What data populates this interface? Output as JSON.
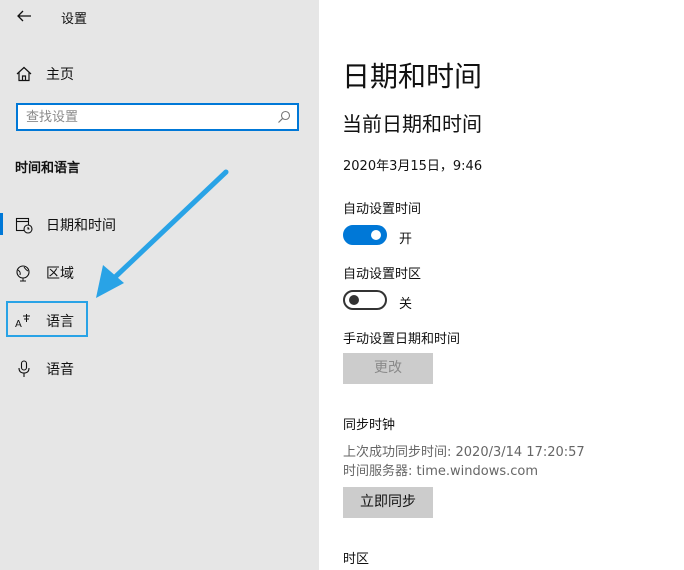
{
  "app": {
    "title": "设置"
  },
  "sidebar": {
    "home_label": "主页",
    "search": {
      "placeholder": "查找设置",
      "value": ""
    },
    "section_title": "时间和语言",
    "items": [
      {
        "label": "日期和时间",
        "icon": "calendar-clock-icon",
        "active": true
      },
      {
        "label": "区域",
        "icon": "globe-icon"
      },
      {
        "label": "语言",
        "icon": "language-icon",
        "highlighted": true
      },
      {
        "label": "语音",
        "icon": "microphone-icon"
      }
    ]
  },
  "main": {
    "page_title": "日期和时间",
    "current_heading": "当前日期和时间",
    "current_datetime": "2020年3月15日，9:46",
    "auto_time": {
      "label": "自动设置时间",
      "state": "开",
      "on": true
    },
    "auto_timezone": {
      "label": "自动设置时区",
      "state": "关",
      "on": false
    },
    "manual": {
      "label": "手动设置日期和时间",
      "button": "更改"
    },
    "sync": {
      "heading": "同步时钟",
      "last_sync": "上次成功同步时间: 2020/3/14 17:20:57",
      "server": "时间服务器: time.windows.com",
      "button": "立即同步"
    },
    "timezone_heading": "时区"
  },
  "colors": {
    "accent": "#0078d7",
    "annotation_arrow": "#29a3e6",
    "sidebar_bg": "#e6e6e6"
  }
}
